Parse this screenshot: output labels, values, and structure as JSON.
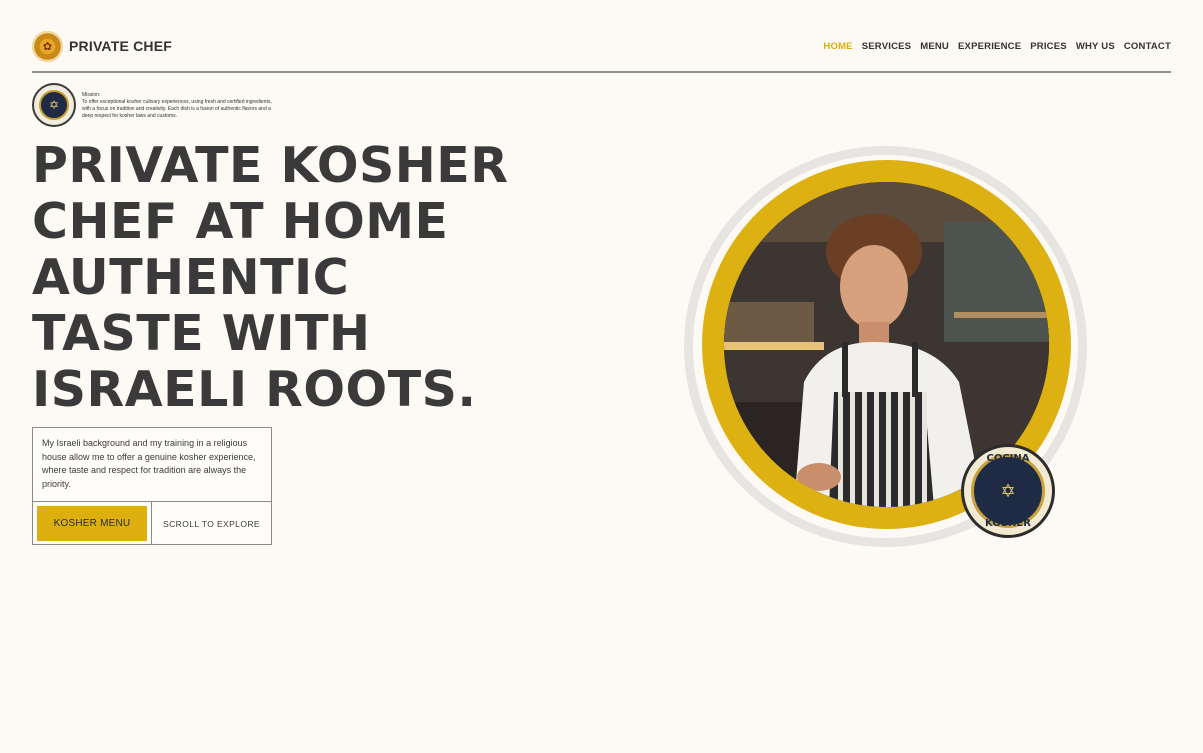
{
  "brand": {
    "name": "PRIVATE CHEF",
    "logo_icon": "chef-logo-icon"
  },
  "nav": [
    {
      "label": "HOME",
      "active": true
    },
    {
      "label": "SERVICES"
    },
    {
      "label": "MENU"
    },
    {
      "label": "EXPERIENCE"
    },
    {
      "label": "PRICES"
    },
    {
      "label": "WHY US"
    },
    {
      "label": "CONTACT"
    }
  ],
  "mission": {
    "label": "Mission:",
    "text": "To offer exceptional kosher culinary experiences, using fresh and certified ingredients, with a focus on tradition and creativity. Each dish is a fusion of authentic flavors and a deep respect for kosher laws and customs."
  },
  "headline": {
    "lines": [
      "PRIVATE KOSHER",
      "CHEF AT HOME",
      "AUTHENTIC",
      "TASTE WITH",
      "ISRAELI ROOTS."
    ]
  },
  "cta": {
    "description": "My Israeli background and my training in a religious house allow me to offer a genuine kosher experience, where taste and respect for tradition are always the priority.",
    "primary_button": "KOSHER MENU",
    "secondary_button": "SCROLL TO EXPLORE"
  },
  "hero_badge": {
    "top": "COCINA",
    "bottom": "KOSHER",
    "icon": "star-of-david-icon"
  },
  "colors": {
    "accent": "#dcaf0e",
    "background": "#fdf9f4",
    "text": "#3a3a3a"
  }
}
